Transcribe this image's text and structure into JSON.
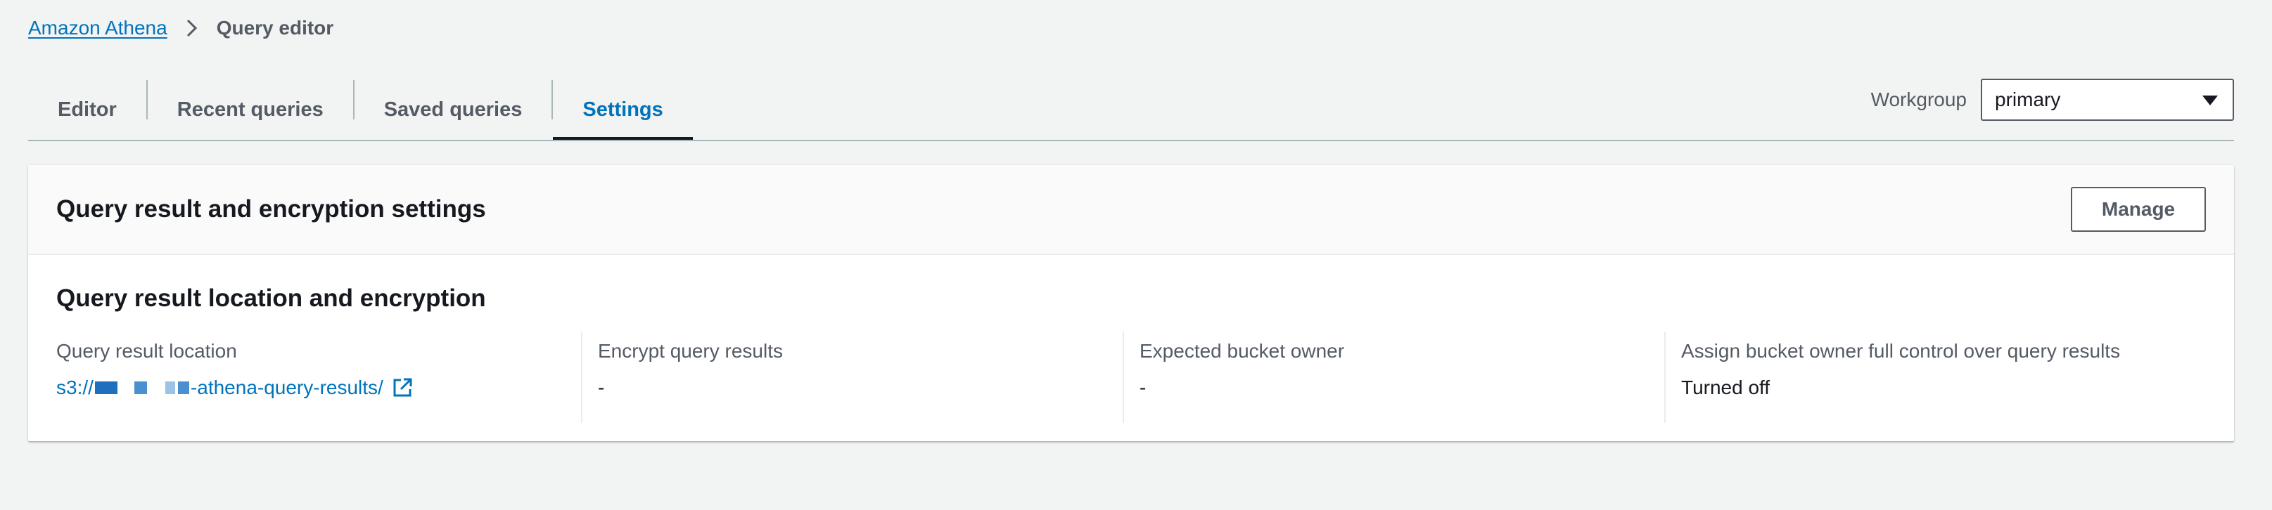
{
  "breadcrumb": {
    "root": "Amazon Athena",
    "current": "Query editor"
  },
  "tabs": [
    {
      "label": "Editor",
      "active": false
    },
    {
      "label": "Recent queries",
      "active": false
    },
    {
      "label": "Saved queries",
      "active": false
    },
    {
      "label": "Settings",
      "active": true
    }
  ],
  "workgroup": {
    "label": "Workgroup",
    "selected": "primary"
  },
  "settings": {
    "title": "Query result and encryption settings",
    "manage_label": "Manage",
    "section_title": "Query result location and encryption",
    "columns": [
      {
        "label": "Query result location",
        "value_prefix": "s3://",
        "value_suffix": "-athena-query-results/"
      },
      {
        "label": "Encrypt query results",
        "value": "-"
      },
      {
        "label": "Expected bucket owner",
        "value": "-"
      },
      {
        "label": "Assign bucket owner full control over query results",
        "value": "Turned off"
      }
    ]
  },
  "colors": {
    "link": "#0073bb",
    "text": "#16191f",
    "muted": "#545b64",
    "background": "#f2f3f3"
  },
  "icons": [
    "chevron-right-icon",
    "caret-down-icon",
    "external-link-icon"
  ]
}
